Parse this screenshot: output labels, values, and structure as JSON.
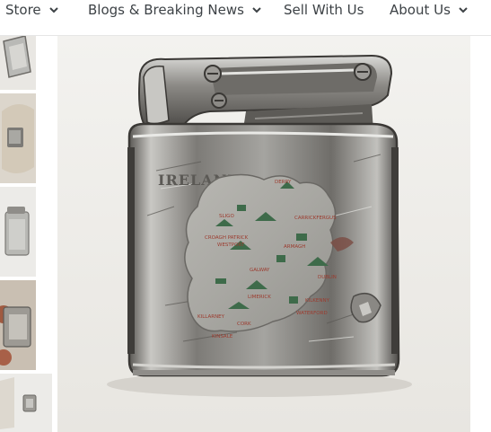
{
  "nav": {
    "items": [
      {
        "label": "Store"
      },
      {
        "label": "Blogs & Breaking News"
      },
      {
        "label": "Sell With Us"
      },
      {
        "label": "About Us"
      }
    ]
  },
  "gallery": {
    "engraving": "IRELAND",
    "map_labels": [
      "DERRY",
      "SLIGO",
      "CARRICKFERGUS",
      "CROAGH PATRICK",
      "WESTPORT",
      "ARMAGH",
      "GALWAY",
      "DUBLIN",
      "LIMERICK",
      "KILKENNY",
      "CORK",
      "KILLARNEY",
      "KINSALE",
      "WATERFORD"
    ]
  },
  "colors": {
    "nav_text": "#3d4246",
    "chrome_light": "#d9d9d6",
    "chrome_dark": "#4a4845",
    "map_plate": "#a8a7a2",
    "map_green": "#3e6b4a",
    "map_red": "#9c3b2e"
  }
}
